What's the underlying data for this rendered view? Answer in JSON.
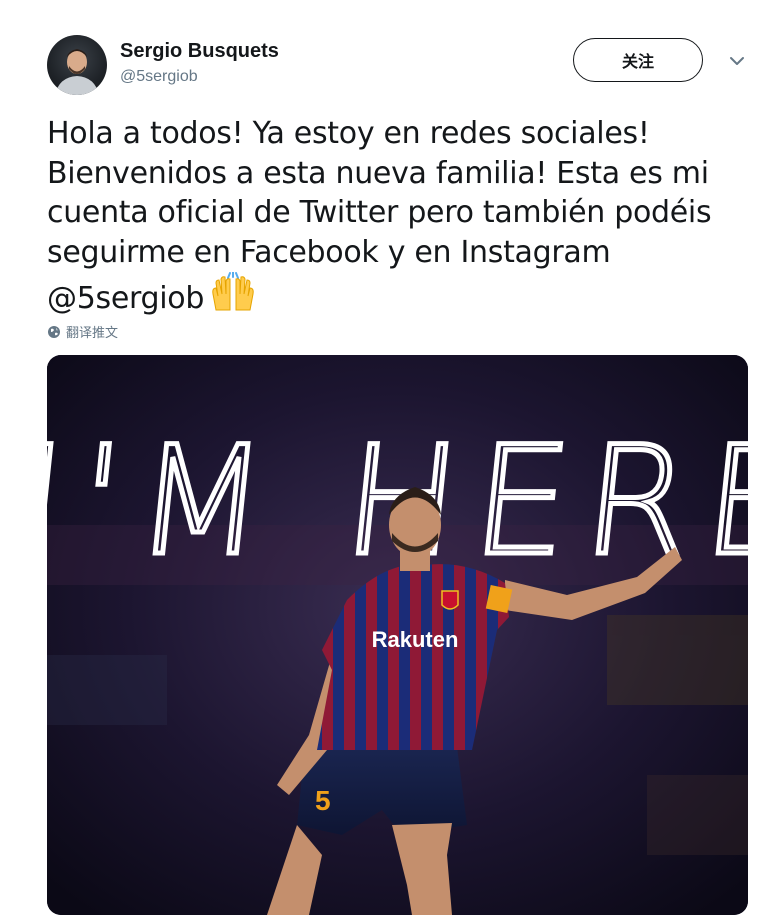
{
  "user": {
    "display_name": "Sergio Busquets",
    "handle": "@5sergiob"
  },
  "actions": {
    "follow_label": "关注"
  },
  "tweet": {
    "lines": [
      "Hola a todos! Ya estoy en redes sociales!",
      "Bienvenidos a esta nueva familia! Esta es mi",
      "cuenta oficial de Twitter pero también podéis",
      "seguirme en Facebook y en Instagram",
      "@5sergiob"
    ],
    "emoji": "raising-hands-emoji",
    "translate_label": "翻译推文"
  },
  "media": {
    "headline": "I'M HERE",
    "shirt_sponsor": "Rakuten",
    "shirt_number": "5"
  },
  "colors": {
    "text": "#14171a",
    "muted": "#657786",
    "stripe_blue": "#1b2c78",
    "stripe_red": "#8f1936",
    "media_bg": "#120f24"
  }
}
